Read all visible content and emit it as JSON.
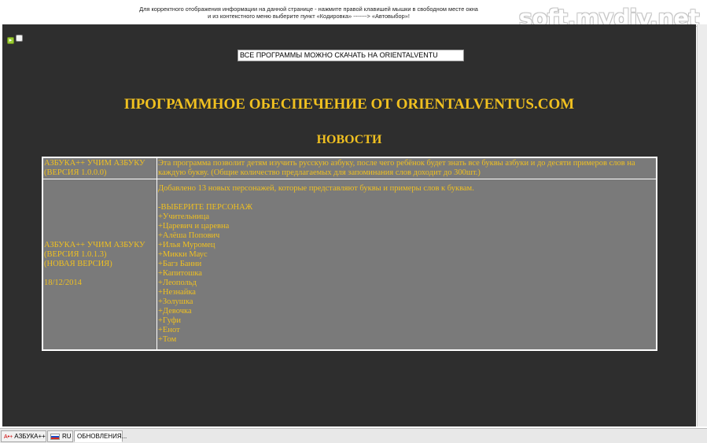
{
  "notice": {
    "line1": "Для корректного отображения информации на данной странице - нажмите правой клавишей мышки в свободном месте окна",
    "line2": "и из контекстного меню выберите пункт «Кодировка» -------> «Автовыбор»!"
  },
  "watermark": "soft.mydiv.net",
  "controls": {
    "play_icon": "play-icon",
    "stop_icon": "stop-icon"
  },
  "download_banner": "ВСЕ ПРОГРАММЫ МОЖНО СКАЧАТЬ НА ORIENTALVENTU",
  "page_title": "ПРОГРАММНОЕ ОБЕСПЕЧЕНИЕ ОТ ORIENTALVENTUS.COM",
  "news_heading": "НОВОСТИ",
  "news": [
    {
      "name": "АЗБУКА++ УЧИМ АЗБУКУ",
      "version": "(ВЕРСИЯ 1.0.0.0)",
      "description": "Эта программа позволит детям изучить русскую азбуку, после чего ребёнок будет знать все буквы азбуки и до десяти примеров слов на каждую букву. (Общие количество предлагаемых для запоминания слов доходит до 300шт.)"
    },
    {
      "name": "АЗБУКА++ УЧИМ АЗБУКУ",
      "version": "(ВЕРСИЯ 1.0.1.3)",
      "note": "(НОВАЯ ВЕРСИЯ)",
      "date": "18/12/2014",
      "intro": "Добавлено 13 новых персонажей, которые представляют буквы и примеры слов к буквам.",
      "list_heading": "-ВЫБЕРИТЕ ПЕРСОНАЖ",
      "characters": [
        "+Учительница",
        "+Царевич и царевна",
        "+Алёша Попович",
        "+Илья Муромец",
        "+Микки Маус",
        "+Багз Банни",
        "+Капитошка",
        "+Леопольд",
        "+Незнайка",
        "+Золушка",
        "+Девочка",
        "+Гуфи",
        "+Енот",
        "+Том"
      ]
    }
  ],
  "taskbar": {
    "tabs": [
      {
        "label": "АЗБУКА++",
        "icon": "abc-icon"
      },
      {
        "label": "RU",
        "icon": "russian-flag-icon"
      },
      {
        "label": "ОБНОВЛЕНИЯ..."
      }
    ],
    "active_tab": 2
  },
  "colors": {
    "background": "#2e2e2e",
    "accent_text": "#f0c020",
    "cell_background": "#7a7a7a"
  }
}
